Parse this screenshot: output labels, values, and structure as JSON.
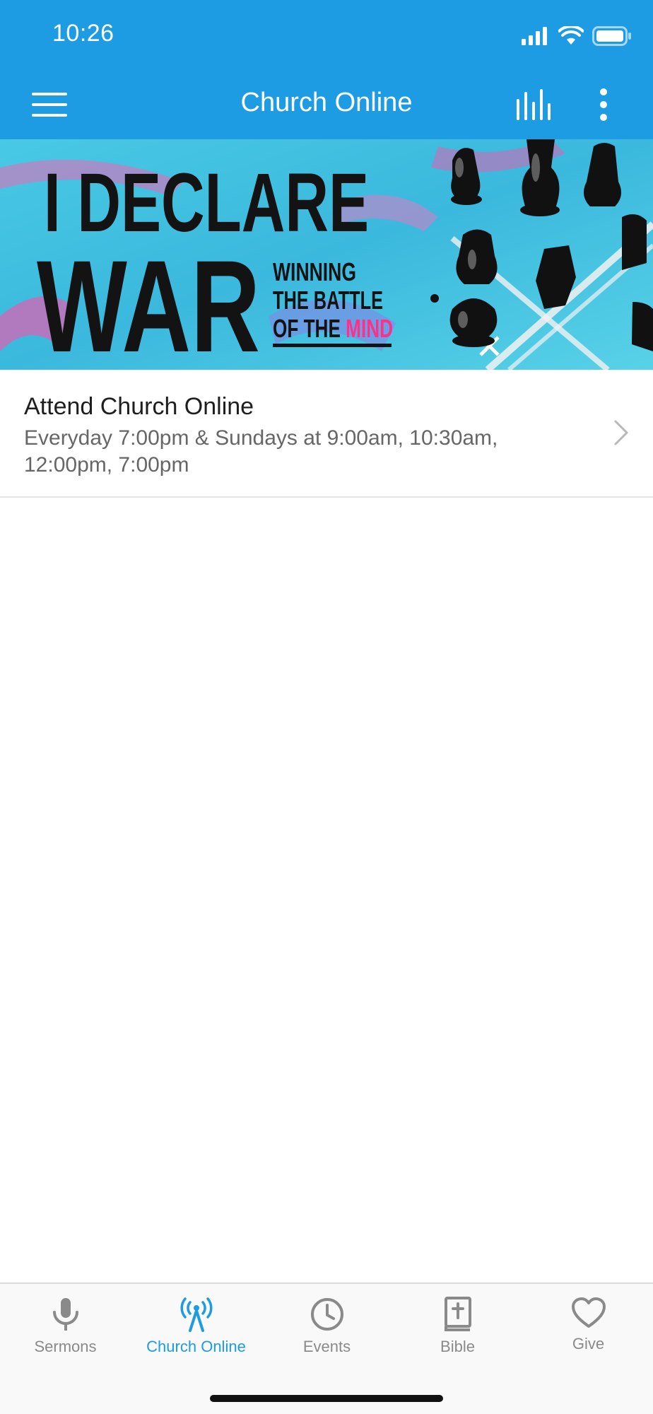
{
  "status": {
    "time": "10:26"
  },
  "header": {
    "title": "Church Online",
    "bg": "#1d9be3",
    "icons": [
      "hamburger-menu-icon",
      "audio-levels-icon",
      "more-vertical-icon"
    ]
  },
  "banner": {
    "line1": "I DECLARE",
    "line2": "WAR",
    "tag1": "WINNING",
    "tag2": "THE BATTLE",
    "tag3a": "OF THE ",
    "tag3b": "MIND"
  },
  "list": {
    "items": [
      {
        "title": "Attend Church Online",
        "subtitle": "Everyday 7:00pm & Sundays at 9:00am, 10:30am, 12:00pm, 7:00pm",
        "icon": "chevron-right-icon"
      }
    ]
  },
  "tabs": [
    {
      "label": "Sermons",
      "icon": "microphone-icon",
      "active": false
    },
    {
      "label": "Church Online",
      "icon": "broadcast-tower-icon",
      "active": true
    },
    {
      "label": "Events",
      "icon": "clock-icon",
      "active": false
    },
    {
      "label": "Bible",
      "icon": "bible-icon",
      "active": false
    },
    {
      "label": "Give",
      "icon": "heart-icon",
      "active": false
    }
  ],
  "colors": {
    "accent": "#1d9be3",
    "inactive": "#8a8a8a",
    "banner_pink": "#ff2f8a"
  }
}
